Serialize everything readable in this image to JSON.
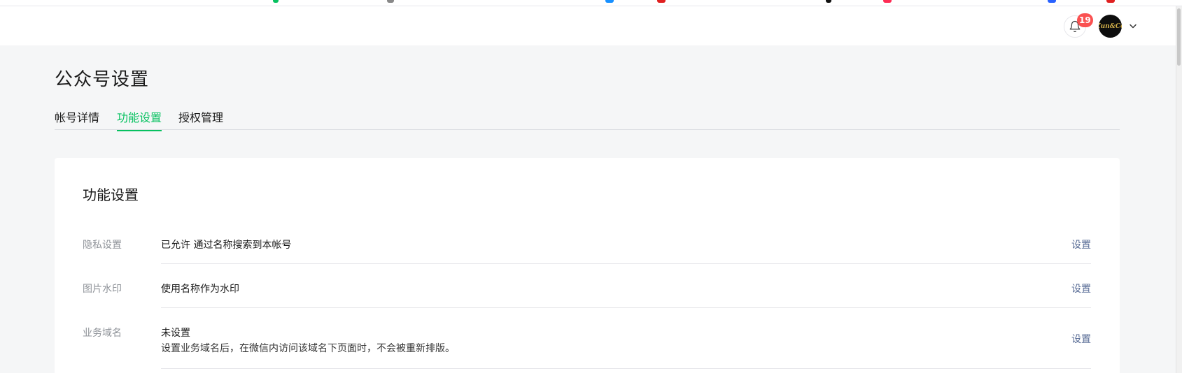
{
  "header": {
    "notification_count": "19",
    "avatar_text": "Zun&Co"
  },
  "page": {
    "title": "公众号设置",
    "tabs": [
      {
        "label": "帐号详情",
        "active": false
      },
      {
        "label": "功能设置",
        "active": true
      },
      {
        "label": "授权管理",
        "active": false
      }
    ]
  },
  "card": {
    "title": "功能设置",
    "rows": [
      {
        "label": "隐私设置",
        "value": "已允许 通过名称搜索到本帐号",
        "action": "设置"
      },
      {
        "label": "图片水印",
        "value": "使用名称作为水印",
        "action": "设置"
      },
      {
        "label": "业务域名",
        "value": "未设置",
        "description": "设置业务域名后，在微信内访问该域名下页面时，不会被重新排版。",
        "action": "设置"
      }
    ]
  },
  "colors": {
    "accent": "#07c160",
    "link": "#576b95",
    "badge": "#fa5151",
    "background": "#f5f6f7"
  }
}
